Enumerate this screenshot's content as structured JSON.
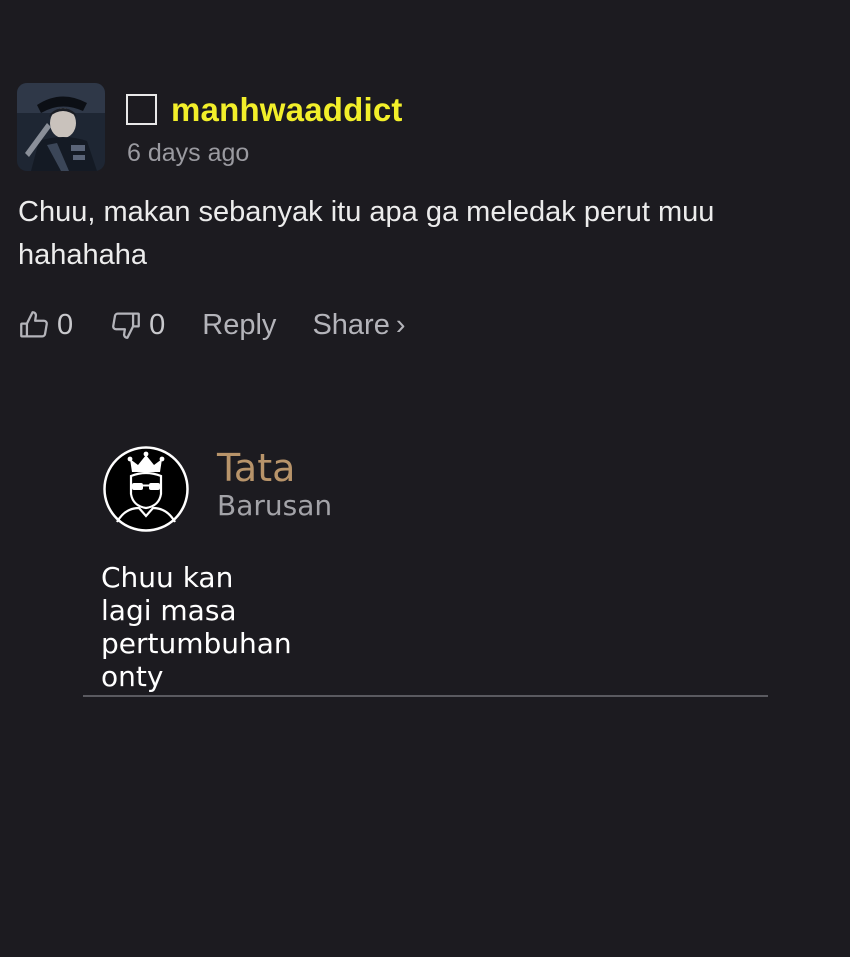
{
  "comment": {
    "username": "manhwaaddict",
    "timestamp": "6 days ago",
    "text": "Chuu, makan sebanyak itu apa ga meledak perut muu hahahaha",
    "likes": "0",
    "dislikes": "0",
    "reply_label": "Reply",
    "share_label": "Share",
    "share_chevron": "›",
    "username_color": "#f2ef2a"
  },
  "reply": {
    "name": "Tata",
    "timestamp": "Barusan",
    "text": "Chuu kan lagi masa pertumbuhan onty",
    "name_color": "#b8946a"
  },
  "icons": {
    "like": "thumbs-up-icon",
    "dislike": "thumbs-down-icon"
  }
}
